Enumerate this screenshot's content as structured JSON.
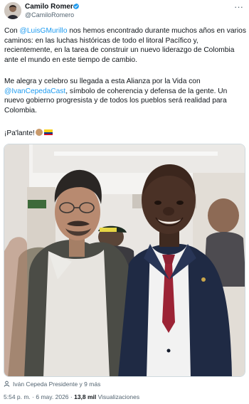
{
  "author": {
    "name": "Camilo Romero",
    "handle": "@CamiloRomero"
  },
  "tweet": {
    "p1_before": "Con ",
    "p1_mention": "@LuisGMurillo",
    "p1_after": " nos hemos encontrado durante muchos años en varios caminos: en las luchas históricas de todo el litoral Pacífico y, recientemente, en la tarea de construir un nuevo liderazgo de Colombia ante el mundo en este tiempo de cambio.",
    "p2_before": "Me alegra y celebro su llegada a esta Alianza por la Vida con ",
    "p2_mention": "@IvanCepedaCast",
    "p2_after": ", símbolo de coherencia y defensa de la gente. Un nuevo gobierno progresista y de todos los pueblos será realidad para Colombia.",
    "p3": "¡Pa'lante!"
  },
  "photo_tags": "Iván Cepeda Presidente y 9 más",
  "meta": {
    "time": "5:54 p. m.",
    "sep": " · ",
    "date": "6 may. 2026",
    "views_count": "13,8 mil",
    "views_label": "Visualizaciones"
  },
  "colors": {
    "accent": "#1d9bf0",
    "text": "#0f1419",
    "muted": "#536471"
  },
  "icons": {
    "verified": "verified-badge-icon",
    "more": "more-options-icon",
    "tag": "person-tag-icon"
  }
}
